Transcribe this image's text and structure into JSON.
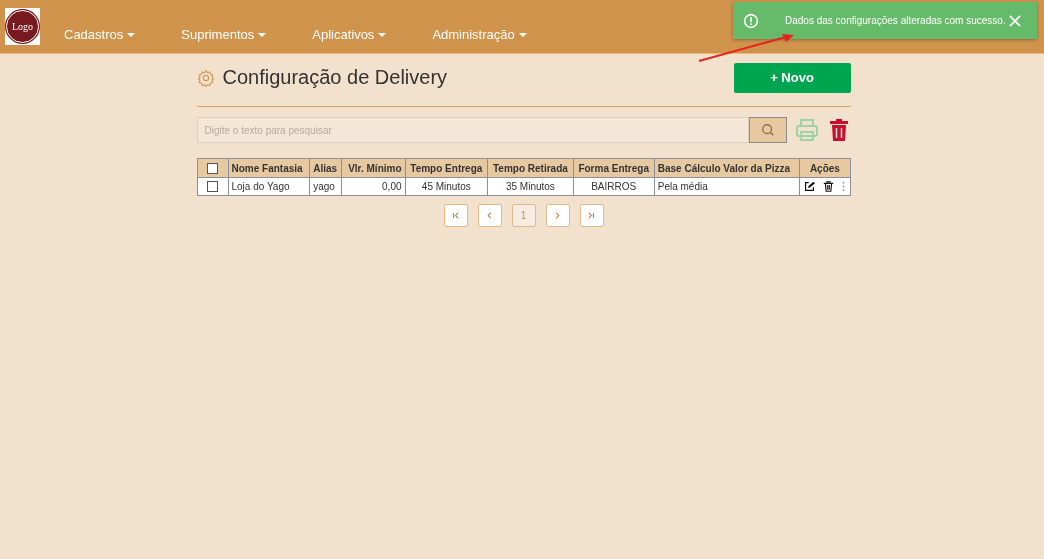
{
  "navbar": {
    "logo": "Logo",
    "menus": [
      {
        "label": "Cadastros"
      },
      {
        "label": "Suprimentos"
      },
      {
        "label": "Aplicativos"
      },
      {
        "label": "Administração"
      }
    ]
  },
  "toast": {
    "message": "Dados das configurações alteradas com sucesso."
  },
  "page": {
    "title": "Configuração de Delivery",
    "new_button": "+ Novo"
  },
  "search": {
    "placeholder": "Digite o texto para pesquisar"
  },
  "table": {
    "header_checked": false,
    "columns": [
      {
        "label": "Nome Fantasia"
      },
      {
        "label": "Alias"
      },
      {
        "label": "Vlr. Mínimo"
      },
      {
        "label": "Tempo Entrega"
      },
      {
        "label": "Tempo Retirada"
      },
      {
        "label": "Forma Entrega"
      },
      {
        "label": "Base Cálculo Valor da Pizza"
      },
      {
        "label": "Ações"
      }
    ],
    "rows": [
      {
        "checked": false,
        "cells": [
          "Loja do Yago",
          "yago",
          "0,00",
          "45 Minutos",
          "35 Minutos",
          "BAIRROS",
          "Pela média"
        ]
      }
    ]
  },
  "pagination": [
    {
      "kind": "first",
      "disabled": false
    },
    {
      "kind": "prev",
      "disabled": false
    },
    {
      "kind": "page",
      "label": "1",
      "selected": true
    },
    {
      "kind": "next",
      "disabled": false
    },
    {
      "kind": "last",
      "disabled": false
    }
  ]
}
